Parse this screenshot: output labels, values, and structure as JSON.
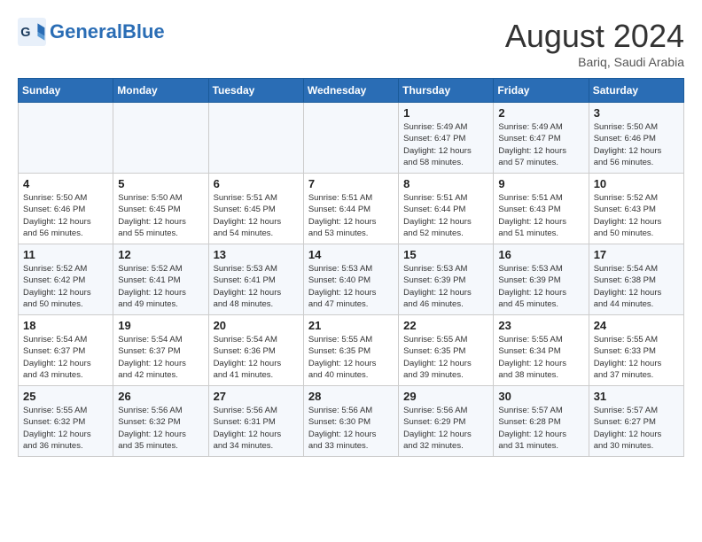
{
  "header": {
    "logo_general": "General",
    "logo_blue": "Blue",
    "month_title": "August 2024",
    "location": "Bariq, Saudi Arabia"
  },
  "weekdays": [
    "Sunday",
    "Monday",
    "Tuesday",
    "Wednesday",
    "Thursday",
    "Friday",
    "Saturday"
  ],
  "weeks": [
    [
      {
        "day": "",
        "info": ""
      },
      {
        "day": "",
        "info": ""
      },
      {
        "day": "",
        "info": ""
      },
      {
        "day": "",
        "info": ""
      },
      {
        "day": "1",
        "info": "Sunrise: 5:49 AM\nSunset: 6:47 PM\nDaylight: 12 hours\nand 58 minutes."
      },
      {
        "day": "2",
        "info": "Sunrise: 5:49 AM\nSunset: 6:47 PM\nDaylight: 12 hours\nand 57 minutes."
      },
      {
        "day": "3",
        "info": "Sunrise: 5:50 AM\nSunset: 6:46 PM\nDaylight: 12 hours\nand 56 minutes."
      }
    ],
    [
      {
        "day": "4",
        "info": "Sunrise: 5:50 AM\nSunset: 6:46 PM\nDaylight: 12 hours\nand 56 minutes."
      },
      {
        "day": "5",
        "info": "Sunrise: 5:50 AM\nSunset: 6:45 PM\nDaylight: 12 hours\nand 55 minutes."
      },
      {
        "day": "6",
        "info": "Sunrise: 5:51 AM\nSunset: 6:45 PM\nDaylight: 12 hours\nand 54 minutes."
      },
      {
        "day": "7",
        "info": "Sunrise: 5:51 AM\nSunset: 6:44 PM\nDaylight: 12 hours\nand 53 minutes."
      },
      {
        "day": "8",
        "info": "Sunrise: 5:51 AM\nSunset: 6:44 PM\nDaylight: 12 hours\nand 52 minutes."
      },
      {
        "day": "9",
        "info": "Sunrise: 5:51 AM\nSunset: 6:43 PM\nDaylight: 12 hours\nand 51 minutes."
      },
      {
        "day": "10",
        "info": "Sunrise: 5:52 AM\nSunset: 6:43 PM\nDaylight: 12 hours\nand 50 minutes."
      }
    ],
    [
      {
        "day": "11",
        "info": "Sunrise: 5:52 AM\nSunset: 6:42 PM\nDaylight: 12 hours\nand 50 minutes."
      },
      {
        "day": "12",
        "info": "Sunrise: 5:52 AM\nSunset: 6:41 PM\nDaylight: 12 hours\nand 49 minutes."
      },
      {
        "day": "13",
        "info": "Sunrise: 5:53 AM\nSunset: 6:41 PM\nDaylight: 12 hours\nand 48 minutes."
      },
      {
        "day": "14",
        "info": "Sunrise: 5:53 AM\nSunset: 6:40 PM\nDaylight: 12 hours\nand 47 minutes."
      },
      {
        "day": "15",
        "info": "Sunrise: 5:53 AM\nSunset: 6:39 PM\nDaylight: 12 hours\nand 46 minutes."
      },
      {
        "day": "16",
        "info": "Sunrise: 5:53 AM\nSunset: 6:39 PM\nDaylight: 12 hours\nand 45 minutes."
      },
      {
        "day": "17",
        "info": "Sunrise: 5:54 AM\nSunset: 6:38 PM\nDaylight: 12 hours\nand 44 minutes."
      }
    ],
    [
      {
        "day": "18",
        "info": "Sunrise: 5:54 AM\nSunset: 6:37 PM\nDaylight: 12 hours\nand 43 minutes."
      },
      {
        "day": "19",
        "info": "Sunrise: 5:54 AM\nSunset: 6:37 PM\nDaylight: 12 hours\nand 42 minutes."
      },
      {
        "day": "20",
        "info": "Sunrise: 5:54 AM\nSunset: 6:36 PM\nDaylight: 12 hours\nand 41 minutes."
      },
      {
        "day": "21",
        "info": "Sunrise: 5:55 AM\nSunset: 6:35 PM\nDaylight: 12 hours\nand 40 minutes."
      },
      {
        "day": "22",
        "info": "Sunrise: 5:55 AM\nSunset: 6:35 PM\nDaylight: 12 hours\nand 39 minutes."
      },
      {
        "day": "23",
        "info": "Sunrise: 5:55 AM\nSunset: 6:34 PM\nDaylight: 12 hours\nand 38 minutes."
      },
      {
        "day": "24",
        "info": "Sunrise: 5:55 AM\nSunset: 6:33 PM\nDaylight: 12 hours\nand 37 minutes."
      }
    ],
    [
      {
        "day": "25",
        "info": "Sunrise: 5:55 AM\nSunset: 6:32 PM\nDaylight: 12 hours\nand 36 minutes."
      },
      {
        "day": "26",
        "info": "Sunrise: 5:56 AM\nSunset: 6:32 PM\nDaylight: 12 hours\nand 35 minutes."
      },
      {
        "day": "27",
        "info": "Sunrise: 5:56 AM\nSunset: 6:31 PM\nDaylight: 12 hours\nand 34 minutes."
      },
      {
        "day": "28",
        "info": "Sunrise: 5:56 AM\nSunset: 6:30 PM\nDaylight: 12 hours\nand 33 minutes."
      },
      {
        "day": "29",
        "info": "Sunrise: 5:56 AM\nSunset: 6:29 PM\nDaylight: 12 hours\nand 32 minutes."
      },
      {
        "day": "30",
        "info": "Sunrise: 5:57 AM\nSunset: 6:28 PM\nDaylight: 12 hours\nand 31 minutes."
      },
      {
        "day": "31",
        "info": "Sunrise: 5:57 AM\nSunset: 6:27 PM\nDaylight: 12 hours\nand 30 minutes."
      }
    ]
  ]
}
